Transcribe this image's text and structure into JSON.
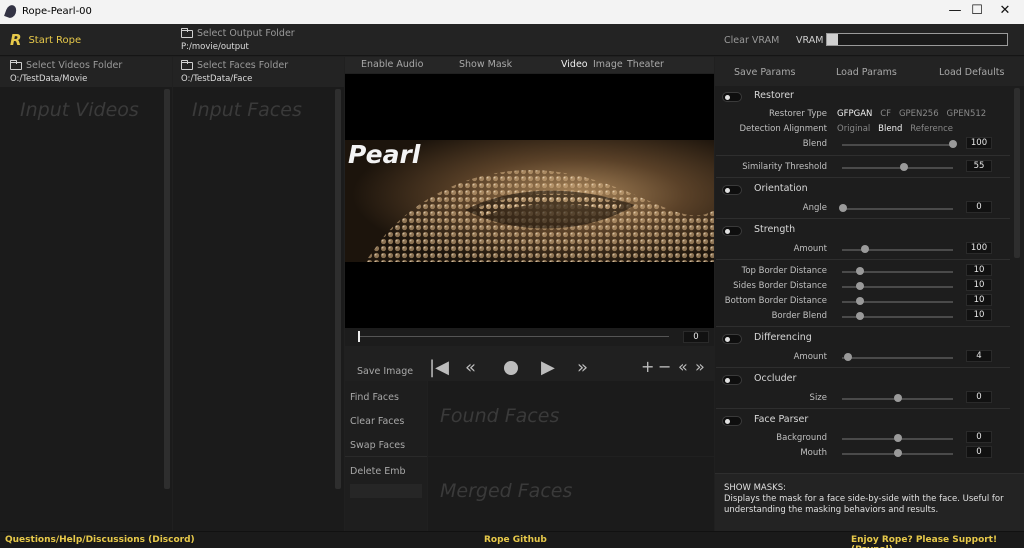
{
  "window": {
    "title": "Rope-Pearl-00",
    "minimize": "—",
    "maximize": "☐",
    "close": "✕"
  },
  "top": {
    "start_rope": "Start Rope",
    "select_output_folder": "Select Output Folder",
    "output_path": "P:/movie/output",
    "clear_vram": "Clear VRAM",
    "vram_label": "VRAM",
    "vram_usage_fraction": 0.06
  },
  "left": {
    "select_videos_folder": "Select Videos Folder",
    "videos_path": "O:/TestData/Movie",
    "input_videos_placeholder": "Input Videos",
    "select_faces_folder": "Select Faces Folder",
    "faces_path": "O:/TestData/Face",
    "input_faces_placeholder": "Input Faces"
  },
  "center": {
    "enable_audio": "Enable Audio",
    "show_mask": "Show Mask",
    "tabs": [
      "Video",
      "Image",
      "Theater"
    ],
    "preview_text": "Pearl",
    "frame_value": "0",
    "save_image": "Save Image",
    "find_faces": "Find Faces",
    "clear_faces": "Clear Faces",
    "swap_faces": "Swap Faces",
    "delete_emb": "Delete Emb",
    "found_faces_placeholder": "Found Faces",
    "merged_faces_placeholder": "Merged Faces"
  },
  "params": {
    "save": "Save Params",
    "load": "Load Params",
    "defaults": "Load Defaults",
    "restorer": "Restorer",
    "restorer_type_label": "Restorer Type",
    "restorer_types": [
      "GFPGAN",
      "CF",
      "GPEN256",
      "GPEN512"
    ],
    "detection_alignment_label": "Detection Alignment",
    "alignments": [
      "Original",
      "Blend",
      "Reference"
    ],
    "blend_label": "Blend",
    "blend_value": "100",
    "similarity_label": "Similarity Threshold",
    "similarity_value": "55",
    "orientation": "Orientation",
    "angle_label": "Angle",
    "angle_value": "0",
    "strength": "Strength",
    "amount_label": "Amount",
    "strength_amount": "100",
    "top_border": "Top Border Distance",
    "top_border_value": "10",
    "sides_border": "Sides Border Distance",
    "sides_border_value": "10",
    "bottom_border": "Bottom Border Distance",
    "bottom_border_value": "10",
    "border_blend": "Border Blend",
    "border_blend_value": "10",
    "differencing": "Differencing",
    "diff_amount": "4",
    "occluder": "Occluder",
    "size_label": "Size",
    "size_value": "0",
    "face_parser": "Face Parser",
    "background_label": "Background",
    "background_value": "0",
    "mouth_label": "Mouth",
    "mouth_value": "0"
  },
  "help": {
    "title": "SHOW MASKS:",
    "text": "Displays the mask for a face side-by-side with the face. Useful for understanding the masking behaviors and results."
  },
  "footer": {
    "discord": "Questions/Help/Discussions (Discord)",
    "github": "Rope Github",
    "support": "Enjoy Rope? Please Support! (Paypal)"
  }
}
